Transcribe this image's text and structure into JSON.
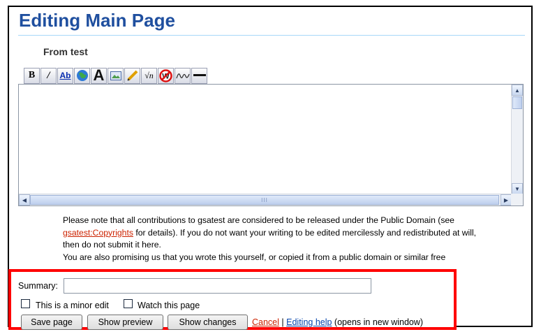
{
  "page": {
    "title": "Editing Main Page",
    "subtitle": "From test"
  },
  "toolbar": {
    "buttons": [
      {
        "name": "bold-icon",
        "glyph": "B"
      },
      {
        "name": "italic-icon",
        "glyph": "I"
      },
      {
        "name": "internal-link-icon",
        "glyph": "Ab"
      },
      {
        "name": "external-link-icon",
        "glyph": ""
      },
      {
        "name": "headline-icon",
        "glyph": "A"
      },
      {
        "name": "embedded-image-icon",
        "glyph": ""
      },
      {
        "name": "media-link-icon",
        "glyph": ""
      },
      {
        "name": "math-formula-icon",
        "glyph": "√n"
      },
      {
        "name": "no-wiki-icon",
        "glyph": "W"
      },
      {
        "name": "signature-icon",
        "glyph": ""
      },
      {
        "name": "horizontal-line-icon",
        "glyph": ""
      }
    ]
  },
  "editor": {
    "content": "",
    "hscroll_label": "III"
  },
  "notice": {
    "line1_text": "Please note that all contributions to gsatest are considered to be released under the Public Domain (see",
    "line2_link": "gsatest:Copyrights",
    "line2_text": " for details). If you do not want your writing to be edited mercilessly and redistributed at will,",
    "line3_text": "then do not submit it here.",
    "line4_text": "You are also promising us that you wrote this yourself, or copied it from a public domain or similar free"
  },
  "form": {
    "summary_label": "Summary:",
    "summary_value": "",
    "minor_edit_label": "This is a minor edit",
    "watch_label": "Watch this page",
    "save_label": "Save page",
    "preview_label": "Show preview",
    "changes_label": "Show changes",
    "cancel_label": "Cancel",
    "separator": " | ",
    "help_label": "Editing help",
    "help_suffix": " (opens in new window)"
  },
  "colors": {
    "title": "#1f4f9f",
    "link_red": "#cc2200",
    "link_blue": "#0645ad",
    "highlight_box": "#ff0000"
  }
}
